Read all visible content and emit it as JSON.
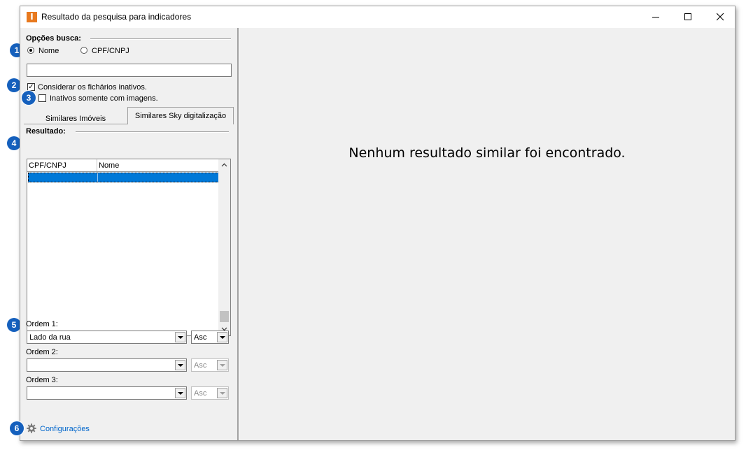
{
  "window": {
    "title": "Resultado da pesquisa para indicadores",
    "app_icon_letter": "I",
    "controls": {
      "minimize": "—",
      "maximize": "☐",
      "close": "✕"
    }
  },
  "search_options": {
    "label": "Opções busca:",
    "radio_nome": "Nome",
    "radio_cpf": "CPF/CNPJ",
    "selected": "Nome",
    "input_value": ""
  },
  "checkboxes": {
    "consider_inactive": {
      "label": "Considerar os fichários inativos.",
      "checked": true
    },
    "inactive_images_only": {
      "label": "Inativos somente com imagens.",
      "checked": false
    }
  },
  "tabs": [
    {
      "label": "Similares Imóveis",
      "active": false
    },
    {
      "label": "Similares Sky digitalização",
      "active": true
    }
  ],
  "result": {
    "label": "Resultado:",
    "columns": [
      "CPF/CNPJ",
      "Nome"
    ]
  },
  "order": [
    {
      "label": "Ordem 1:",
      "value": "Lado da rua",
      "direction": "Asc",
      "enabled": true
    },
    {
      "label": "Ordem 2:",
      "value": "",
      "direction": "Asc",
      "enabled": false
    },
    {
      "label": "Ordem 3:",
      "value": "",
      "direction": "Asc",
      "enabled": false
    }
  ],
  "settings_link": "Configurações",
  "message": "Nenhum resultado similar foi encontrado.",
  "badges": [
    "1",
    "2",
    "3",
    "4",
    "5",
    "6"
  ],
  "colors": {
    "badge": "#1560bd",
    "selection": "#0078d7",
    "app_icon": "#e8791e",
    "link": "#0066cc"
  }
}
